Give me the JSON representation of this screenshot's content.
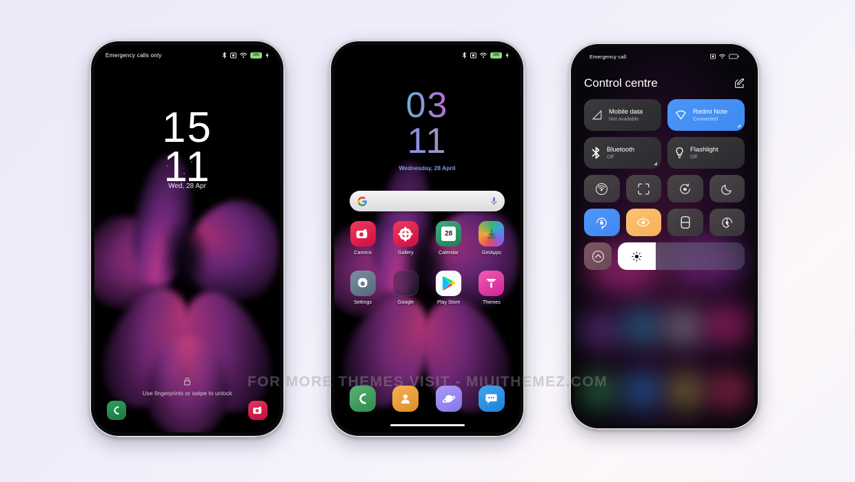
{
  "background_color": "#eceaf9",
  "watermark": "FOR MORE THEMES VISIT - MIUITHEMEZ.COM",
  "phone1": {
    "statusbar": {
      "carrier": "Emergency calls only",
      "battery_level": "100",
      "icons": [
        "bluetooth-icon",
        "cast-icon",
        "wifi-icon",
        "battery-icon",
        "charging-bolt-icon"
      ]
    },
    "clock_hours": "15",
    "clock_minutes": "11",
    "date": "Wed, 28 Apr",
    "unlock_hint": "Use fingerprints or swipe to unlock",
    "shortcut_left": "phone-shortcut",
    "shortcut_right": "camera-shortcut"
  },
  "phone2": {
    "statusbar": {
      "carrier": "",
      "battery_level": "100",
      "icons": [
        "bluetooth-icon",
        "cast-icon",
        "wifi-icon",
        "battery-icon",
        "charging-bolt-icon"
      ]
    },
    "clock_hours": "03",
    "clock_minutes": "11",
    "date": "Wednesday, 28 April",
    "search": {
      "placeholder": "",
      "value": "",
      "logo": "google-g-icon",
      "mic": "microphone-icon"
    },
    "apps": [
      {
        "label": "Camera",
        "icon": "camera-icon",
        "color": "#e5254f"
      },
      {
        "label": "Gallery",
        "icon": "gallery-icon",
        "color": "#e5254f"
      },
      {
        "label": "Calendar",
        "icon": "calendar-icon",
        "color": "#2f9d6f",
        "day": "28"
      },
      {
        "label": "GetApps",
        "icon": "getapps-icon",
        "color": "#4caf50"
      },
      {
        "label": "Settings",
        "icon": "settings-gear-icon",
        "color": "#6b7f92"
      },
      {
        "label": "Google",
        "icon": "google-folder-icon",
        "color": "#2a2030"
      },
      {
        "label": "Play Store",
        "icon": "play-store-icon",
        "color": "#ffffff"
      },
      {
        "label": "Themes",
        "icon": "themes-icon",
        "color": "#e0359b"
      }
    ],
    "dock": [
      {
        "label": "Phone",
        "icon": "phone-handset-icon",
        "color": "#45a05e"
      },
      {
        "label": "Contacts",
        "icon": "contacts-person-icon",
        "color": "#eba03c"
      },
      {
        "label": "Browser",
        "icon": "browser-planet-icon",
        "color": "#9b8df0"
      },
      {
        "label": "Messages",
        "icon": "messages-bubble-icon",
        "color": "#2e97e8"
      }
    ]
  },
  "phone3": {
    "statusbar": {
      "carrier": "Emergency call",
      "battery_level": "",
      "icons": [
        "cast-icon",
        "wifi-icon",
        "battery-icon"
      ]
    },
    "title": "Control centre",
    "edit_icon": "edit-pencil-icon",
    "tiles": [
      {
        "name": "Mobile data",
        "status": "Not available",
        "icon": "mobile-data-icon",
        "active": false,
        "expand": false
      },
      {
        "name": "Redmi Note",
        "status": "Connected",
        "icon": "wifi-tile-icon",
        "active": true,
        "expand": true
      },
      {
        "name": "Bluetooth",
        "status": "Off",
        "icon": "bluetooth-tile-icon",
        "active": false,
        "expand": true
      },
      {
        "name": "Flashlight",
        "status": "Off",
        "icon": "flashlight-icon",
        "active": false,
        "expand": false
      }
    ],
    "toggles": [
      {
        "icon": "hotspot-icon",
        "state": "off"
      },
      {
        "icon": "scan-frame-icon",
        "state": "off"
      },
      {
        "icon": "screenshot-icon",
        "state": "off"
      },
      {
        "icon": "dark-mode-moon-icon",
        "state": "off"
      },
      {
        "icon": "rotation-lock-icon",
        "state": "on-blue"
      },
      {
        "icon": "reading-mode-eye-icon",
        "state": "on-orange"
      },
      {
        "icon": "battery-saver-icon",
        "state": "off"
      },
      {
        "icon": "cast-screen-icon",
        "state": "off"
      }
    ],
    "bottom_toggle": {
      "icon": "dnd-icon",
      "state": "off"
    },
    "brightness": {
      "icon": "brightness-sun-icon",
      "value": 30
    }
  }
}
